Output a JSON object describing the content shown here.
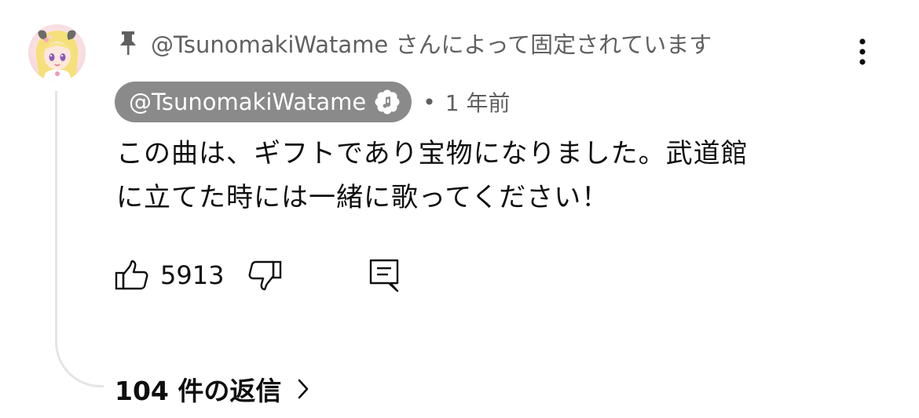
{
  "comment": {
    "pinned_text": "@TsunomakiWatame さんによって固定されています",
    "author": "@TsunomakiWatame",
    "separator": "•",
    "time": "1 年前",
    "text_lines": [
      "この曲は、ギフトであり宝物になりました。武道館",
      "に立てた時には一緒に歌ってください！"
    ],
    "likes": "5913",
    "replies_label": "104 件の返信"
  },
  "icons": {
    "pin": "pin-icon",
    "badge": "music-artist-badge-icon",
    "more": "more-vert-icon",
    "like": "thumb-up-icon",
    "dislike": "thumb-down-icon",
    "reply": "reply-comment-icon",
    "chevron": "chevron-right-icon"
  },
  "colors": {
    "author_chip_bg": "#8a8a8a",
    "secondary_text": "#606060",
    "thread_line": "#e5e5e5"
  }
}
